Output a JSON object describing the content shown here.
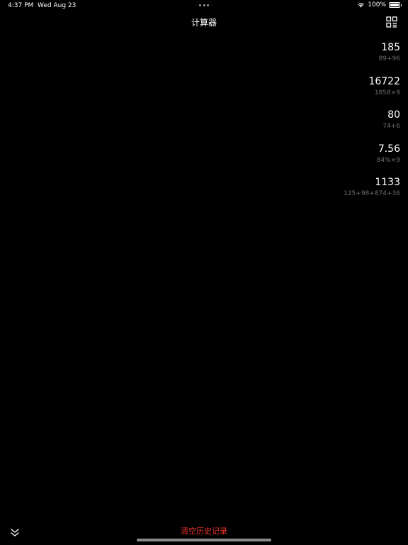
{
  "status_bar": {
    "time": "4:37 PM",
    "date": "Wed Aug 23",
    "battery": "100%"
  },
  "nav": {
    "title": "计算器"
  },
  "history": [
    {
      "result": "185",
      "expression": "89+96"
    },
    {
      "result": "16722",
      "expression": "1858×9"
    },
    {
      "result": "80",
      "expression": "74+6"
    },
    {
      "result": "7.56",
      "expression": "84%×9"
    },
    {
      "result": "1133",
      "expression": "125+98+874+36"
    }
  ],
  "bottom": {
    "clear_label": "清空历史记录"
  },
  "colors": {
    "background": "#000000",
    "accent_red": "#e8322b",
    "secondary_text": "#6e6e6e"
  }
}
